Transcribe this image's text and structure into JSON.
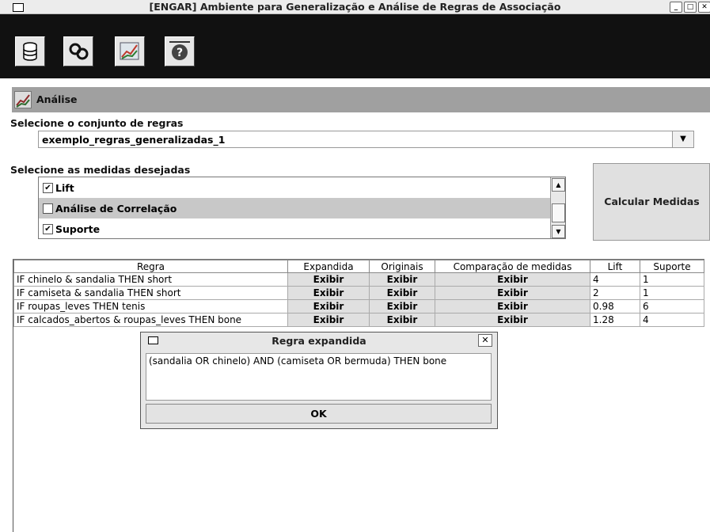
{
  "window": {
    "title": "[ENGAR] Ambiente para Generalização e Análise de Regras de Associação"
  },
  "toolbar": {
    "tools": [
      "database-icon",
      "chain-link-icon",
      "chart-icon",
      "help-icon"
    ]
  },
  "section": {
    "title": "Análise"
  },
  "ruleset": {
    "label": "Selecione o conjunto de regras",
    "selected": "exemplo_regras_generalizadas_1"
  },
  "measures": {
    "label": "Selecione as medidas desejadas",
    "items": [
      {
        "label": "Lift",
        "checked": true
      },
      {
        "label": "Análise de Correlação",
        "checked": false
      },
      {
        "label": "Suporte",
        "checked": true
      }
    ]
  },
  "calc_button": {
    "label": "Calcular Medidas"
  },
  "table": {
    "headers": [
      "Regra",
      "Expandida",
      "Originais",
      "Comparação de medidas",
      "Lift",
      "Suporte"
    ],
    "rows": [
      {
        "regra": "IF chinelo & sandalia THEN short",
        "expandida": "Exibir",
        "originais": "Exibir",
        "comparacao": "Exibir",
        "lift": "4",
        "suporte": "1"
      },
      {
        "regra": "IF camiseta & sandalia THEN short",
        "expandida": "Exibir",
        "originais": "Exibir",
        "comparacao": "Exibir",
        "lift": "2",
        "suporte": "1"
      },
      {
        "regra": "IF roupas_leves THEN tenis",
        "expandida": "Exibir",
        "originais": "Exibir",
        "comparacao": "Exibir",
        "lift": "0.98",
        "suporte": "6"
      },
      {
        "regra": "IF calcados_abertos & roupas_leves THEN bone",
        "expandida": "Exibir",
        "originais": "Exibir",
        "comparacao": "Exibir",
        "lift": "1.28",
        "suporte": "4"
      }
    ]
  },
  "dialog": {
    "title": "Regra expandida",
    "text": "(sandalia OR chinelo)  AND (camiseta OR bermuda)  THEN bone",
    "ok_label": "OK",
    "close_glyph": "✕"
  },
  "glyphs": {
    "check": "✔",
    "down": "▼",
    "up": "▲",
    "minimize": "_",
    "maximize": "□",
    "close": "✕"
  }
}
